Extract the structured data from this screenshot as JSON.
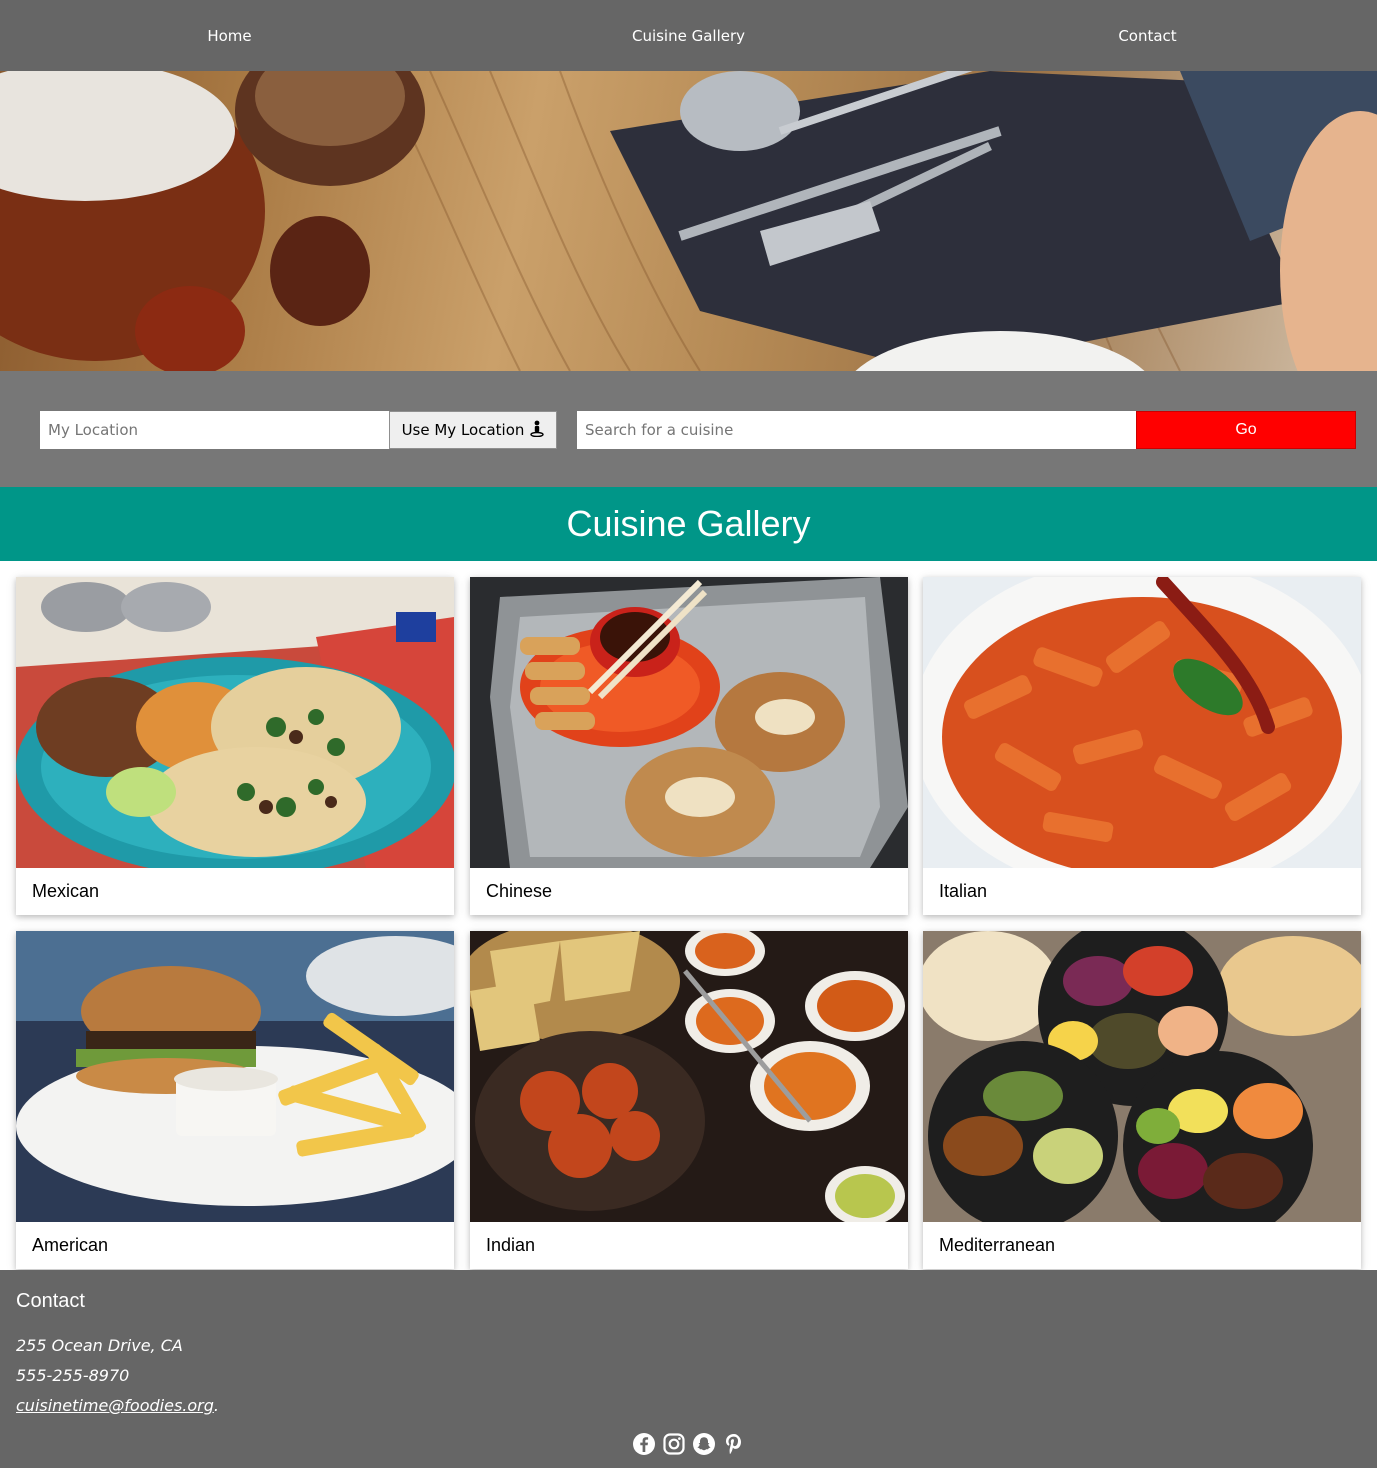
{
  "nav": {
    "items": [
      {
        "label": "Home"
      },
      {
        "label": "Cuisine Gallery"
      },
      {
        "label": "Contact"
      }
    ]
  },
  "search": {
    "location_placeholder": "My Location",
    "use_location_label": "Use My Location",
    "cuisine_placeholder": "Search for a cuisine",
    "go_label": "Go"
  },
  "gallery": {
    "title": "Cuisine Gallery",
    "cards": [
      {
        "label": "Mexican"
      },
      {
        "label": "Chinese"
      },
      {
        "label": "Italian"
      },
      {
        "label": "American"
      },
      {
        "label": "Indian"
      },
      {
        "label": "Mediterranean"
      }
    ]
  },
  "footer": {
    "title": "Contact",
    "address": "255 Ocean Drive, CA",
    "phone": "555-255-8970",
    "email": "cuisinetime@foodies.org",
    "email_suffix": ".",
    "socials": [
      "facebook-icon",
      "instagram-icon",
      "snapchat-icon",
      "pinterest-icon"
    ]
  },
  "colors": {
    "nav_bg": "#666666",
    "search_band_bg": "#777777",
    "go_button": "#ff0000",
    "gallery_header": "#009688",
    "footer_bg": "#666666"
  }
}
